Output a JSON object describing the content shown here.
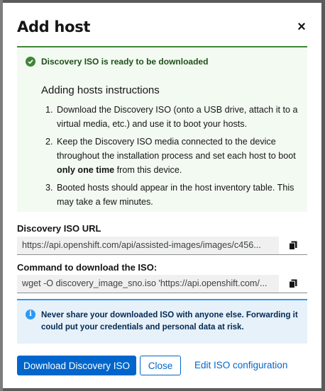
{
  "modal": {
    "title": "Add host",
    "close_icon": "close-icon"
  },
  "success_alert": {
    "icon": "check-circle-icon",
    "title": "Discovery ISO is ready to be downloaded",
    "instructions_title": "Adding hosts instructions",
    "steps": [
      "Download the Discovery ISO (onto a USB drive, attach it to a virtual media, etc.) and use it to boot your hosts.",
      "Keep the Discovery ISO media connected to the device throughout the installation process and set each host to boot ",
      "Booted hosts should appear in the host inventory table. This may take a few minutes."
    ],
    "step2_bold": "only one time",
    "step2_tail": " from this device."
  },
  "iso_url": {
    "label": "Discovery ISO URL",
    "value": "https://api.openshift.com/api/assisted-images/images/c456...",
    "copy_icon": "copy-icon"
  },
  "iso_command": {
    "label": "Command to download the ISO:",
    "value": "wget -O discovery_image_sno.iso 'https://api.openshift.com/...",
    "copy_icon": "copy-icon"
  },
  "info_alert": {
    "icon": "info-circle-icon",
    "text": "Never share your downloaded ISO with anyone else. Forwarding it could put your credentials and personal data at risk."
  },
  "footer": {
    "download_label": "Download Discovery ISO",
    "close_label": "Close",
    "edit_label": "Edit ISO configuration"
  },
  "colors": {
    "primary": "#0066cc",
    "success": "#3e8635",
    "info": "#2b9af3"
  }
}
